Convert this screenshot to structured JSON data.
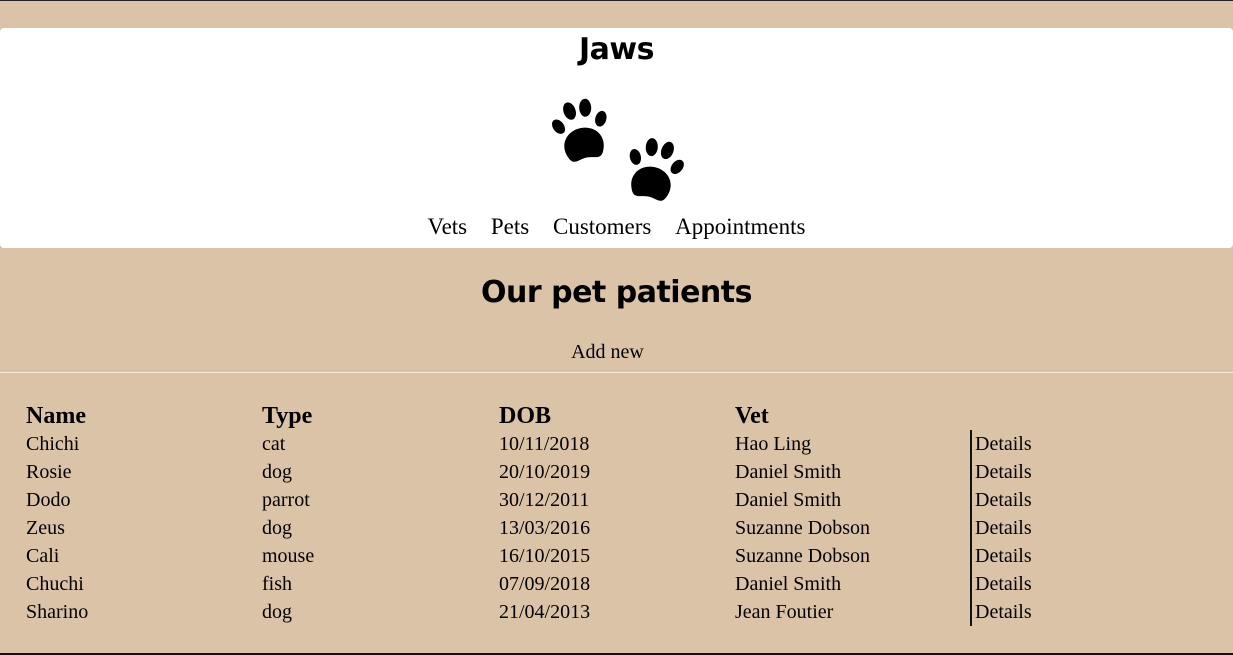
{
  "site": {
    "title": "Jaws",
    "logo_icon": "paw-prints-icon"
  },
  "nav": {
    "items": [
      {
        "label": "Vets"
      },
      {
        "label": "Pets"
      },
      {
        "label": "Customers"
      },
      {
        "label": "Appointments"
      }
    ]
  },
  "page": {
    "heading": "Our pet patients",
    "add_new_label": "Add new"
  },
  "table": {
    "headers": [
      "Name",
      "Type",
      "DOB",
      "Vet",
      ""
    ],
    "rows": [
      {
        "name": "Chichi",
        "type": "cat",
        "dob": "10/11/2018",
        "vet": "Hao Ling",
        "details": "Details"
      },
      {
        "name": "Rosie",
        "type": "dog",
        "dob": "20/10/2019",
        "vet": "Daniel Smith",
        "details": "Details"
      },
      {
        "name": "Dodo",
        "type": "parrot",
        "dob": "30/12/2011",
        "vet": "Daniel Smith",
        "details": "Details"
      },
      {
        "name": "Zeus",
        "type": "dog",
        "dob": "13/03/2016",
        "vet": "Suzanne Dobson",
        "details": "Details"
      },
      {
        "name": "Cali",
        "type": "mouse",
        "dob": "16/10/2015",
        "vet": "Suzanne Dobson",
        "details": "Details"
      },
      {
        "name": "Chuchi",
        "type": "fish",
        "dob": "07/09/2018",
        "vet": "Daniel Smith",
        "details": "Details"
      },
      {
        "name": "Sharino",
        "type": "dog",
        "dob": "21/04/2013",
        "vet": "Jean Foutier",
        "details": "Details"
      }
    ]
  },
  "colors": {
    "page_background": "#dbc3a8",
    "header_background": "#ffffff",
    "text": "#000000"
  }
}
